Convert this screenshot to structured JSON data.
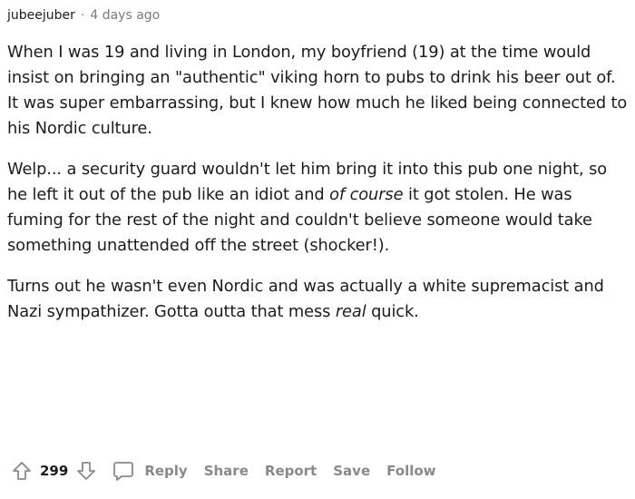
{
  "comment": {
    "author": "jubeejuber",
    "separator": "·",
    "age": "4 days ago",
    "paragraphs": [
      {
        "text_parts": [
          {
            "text": "When I was 19 and living in London, my boyfriend (19) at the time would insist on bringing an \"authentic\" viking horn to pubs to drink his beer out of. It was super embarrassing, but I knew how much he liked being connected to his Nordic culture.",
            "italic": false
          }
        ]
      },
      {
        "text_parts": [
          {
            "text": "Welp... a security guard wouldn't let him bring it into this pub one night, so he left it out of the pub like an idiot and ",
            "italic": false
          },
          {
            "text": "of course",
            "italic": true
          },
          {
            "text": " it got stolen. He was fuming for the rest of the night and couldn't believe someone would take something unattended off the street (shocker!).",
            "italic": false
          }
        ]
      },
      {
        "text_parts": [
          {
            "text": "Turns out he wasn't even Nordic and was actually a white supremacist and Nazi sympathizer. Gotta outta that mess ",
            "italic": false
          },
          {
            "text": "real",
            "italic": true
          },
          {
            "text": " quick.",
            "italic": false
          }
        ]
      }
    ]
  },
  "actions": {
    "score": "299",
    "upvote_icon": "arrow-up-icon",
    "downvote_icon": "arrow-down-icon",
    "reply_icon": "speech-bubble-icon",
    "reply_label": "Reply",
    "share_label": "Share",
    "report_label": "Report",
    "save_label": "Save",
    "follow_label": "Follow"
  },
  "colors": {
    "text": "#1c1c1c",
    "meta": "#7c7c7c",
    "action": "#878a8c",
    "background": "#ffffff"
  }
}
